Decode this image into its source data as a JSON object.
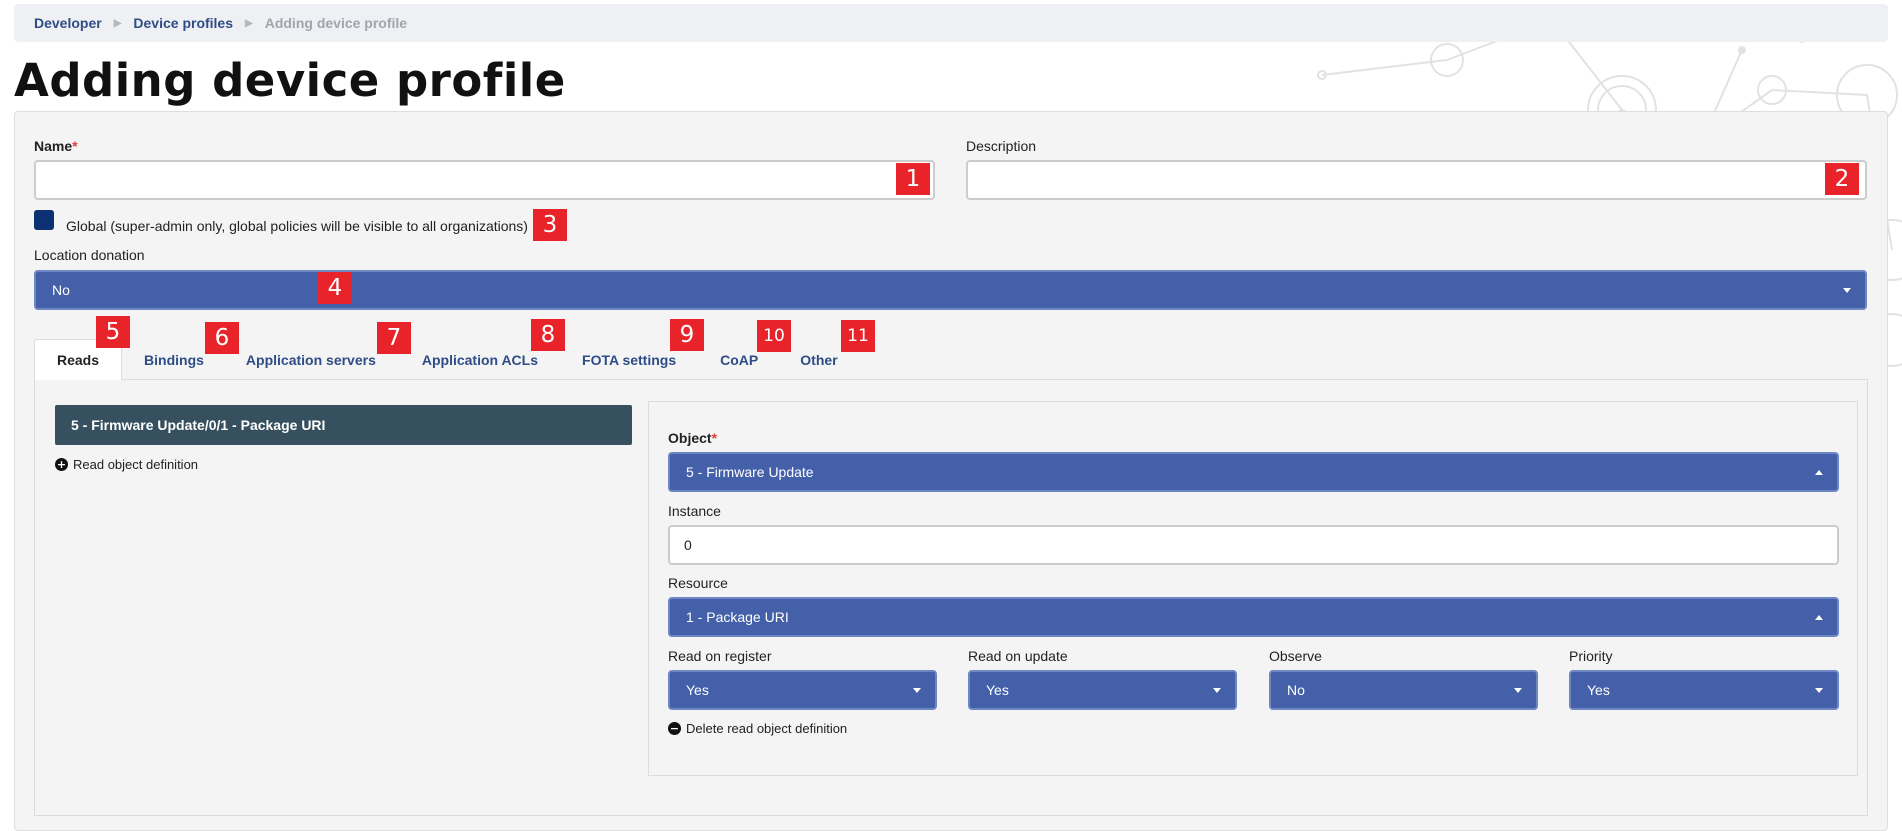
{
  "breadcrumb": {
    "items": [
      "Developer",
      "Device profiles"
    ],
    "current": "Adding device profile"
  },
  "page_title": "Adding device profile",
  "form": {
    "name_label": "Name",
    "required_mark": "*",
    "name_value": "",
    "description_label": "Description",
    "description_value": "",
    "global_label": "Global (super-admin only, global policies will be visible to all organizations)",
    "location_label": "Location donation",
    "location_value": "No"
  },
  "tabs": [
    "Reads",
    "Bindings",
    "Application servers",
    "Application ACLs",
    "FOTA settings",
    "CoAP",
    "Other"
  ],
  "reads": {
    "item_title": "5 - Firmware Update/0/1 - Package URI",
    "read_object_link": "Read object definition",
    "object_label": "Object",
    "object_value": "5 - Firmware Update",
    "instance_label": "Instance",
    "instance_value": "0",
    "resource_label": "Resource",
    "resource_value": "1 - Package URI",
    "read_on_register_label": "Read on register",
    "read_on_register_value": "Yes",
    "read_on_update_label": "Read on update",
    "read_on_update_value": "Yes",
    "observe_label": "Observe",
    "observe_value": "No",
    "priority_label": "Priority",
    "priority_value": "Yes",
    "delete_link": "Delete read object definition"
  },
  "annotations": [
    "1",
    "2",
    "3",
    "4",
    "5",
    "6",
    "7",
    "8",
    "9",
    "10",
    "11"
  ],
  "colors": {
    "select_bg": "#4360a8",
    "badge": "#e8232a",
    "item_bar": "#36505f",
    "link": "#2e4d86"
  }
}
